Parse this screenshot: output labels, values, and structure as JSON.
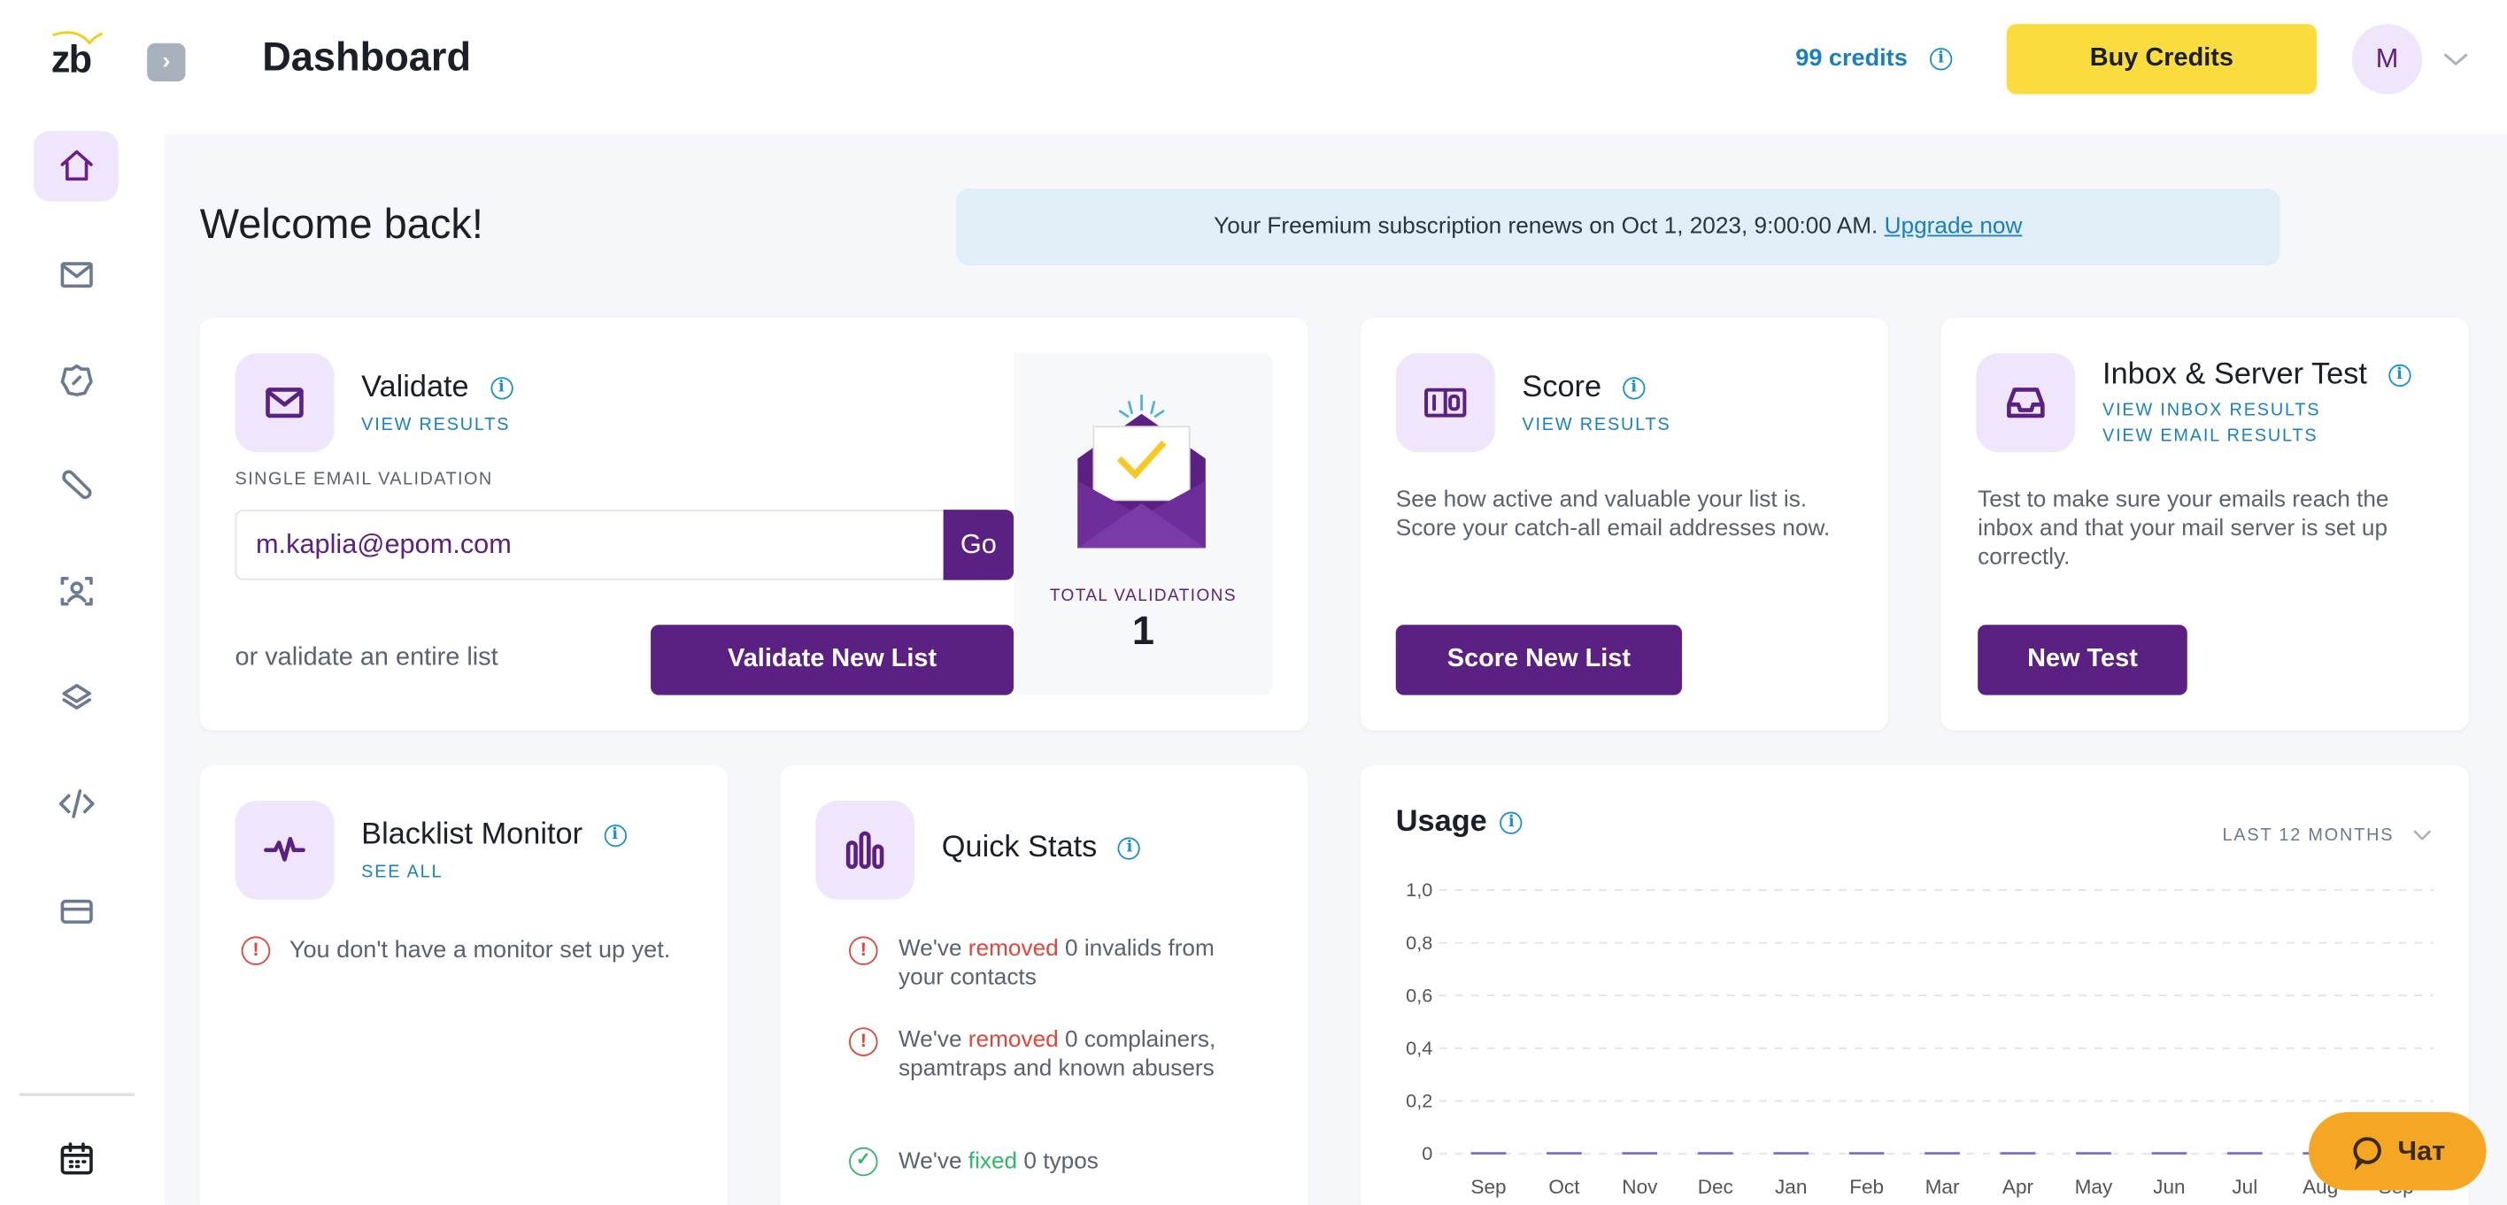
{
  "app": {
    "logo": "zb",
    "page_title": "Dashboard"
  },
  "header": {
    "credits": "99 credits",
    "buy_credits": "Buy Credits",
    "avatar_initial": "M"
  },
  "sidebar": {
    "items": [
      {
        "icon": "home-icon",
        "active": true
      },
      {
        "icon": "mail-icon"
      },
      {
        "icon": "discount-badge-icon"
      },
      {
        "icon": "tools-icon"
      },
      {
        "icon": "user-scan-icon"
      },
      {
        "icon": "layers-icon"
      },
      {
        "icon": "code-icon"
      },
      {
        "icon": "credit-card-icon"
      },
      {
        "icon": "calendar-icon"
      }
    ]
  },
  "welcome": "Welcome back!",
  "banner": {
    "text": "Your Freemium subscription renews on Oct 1, 2023, 9:00:00 AM.",
    "link": "Upgrade now"
  },
  "validate": {
    "title": "Validate",
    "view_results": "VIEW RESULTS",
    "single_label": "SINGLE EMAIL VALIDATION",
    "email_value": "m.kaplia@epom.com",
    "go": "Go",
    "or_text": "or validate an entire list",
    "button": "Validate New List",
    "total_label": "TOTAL VALIDATIONS",
    "total_value": "1"
  },
  "score": {
    "title": "Score",
    "view_results": "VIEW RESULTS",
    "description": "See how active and valuable your list is. Score your catch-all email addresses now.",
    "button": "Score New List"
  },
  "inbox": {
    "title": "Inbox & Server Test",
    "link1": "VIEW INBOX RESULTS",
    "link2": "VIEW EMAIL RESULTS",
    "description": "Test to make sure your emails reach the inbox and that your mail server is set up correctly.",
    "button": "New Test"
  },
  "blacklist": {
    "title": "Blacklist Monitor",
    "see_all": "SEE ALL",
    "message": "You don't have a monitor set up yet."
  },
  "quick_stats": {
    "title": "Quick Stats",
    "items": [
      {
        "pre": "We've ",
        "hl": "removed",
        "post": " 0 invalids from your contacts",
        "status": "warning"
      },
      {
        "pre": "We've ",
        "hl": "removed",
        "post": " 0 complainers, spamtraps and known abusers",
        "status": "warning"
      },
      {
        "pre": "We've ",
        "hl": "fixed",
        "post": " 0 typos",
        "status": "ok"
      }
    ]
  },
  "usage": {
    "title": "Usage",
    "range": "LAST 12 MONTHS"
  },
  "chart_data": {
    "type": "bar",
    "categories": [
      "Sep",
      "Oct",
      "Nov",
      "Dec",
      "Jan",
      "Feb",
      "Mar",
      "Apr",
      "May",
      "Jun",
      "Jul",
      "Aug",
      "Sep"
    ],
    "values": [
      0,
      0,
      0,
      0,
      0,
      0,
      0,
      0,
      0,
      0,
      0,
      0,
      0
    ],
    "ylim": [
      0,
      1
    ],
    "yticks": [
      "0",
      "0,2",
      "0,4",
      "0,6",
      "0,8",
      "1,0"
    ],
    "grid": true,
    "bar_color": "#7b6cc9"
  },
  "chat": {
    "label": "Чат"
  },
  "colors": {
    "primary": "#5b2182",
    "accent_yellow": "#fbdc3e",
    "link": "#1a7fc1",
    "chat": "#f5a623"
  }
}
